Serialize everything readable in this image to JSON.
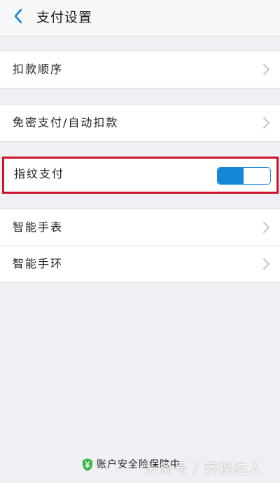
{
  "header": {
    "title": "支付设置",
    "back_icon": "chevron-left-icon"
  },
  "groups": [
    {
      "rows": [
        {
          "label": "扣款顺序",
          "icon": "chevron-right-icon"
        }
      ]
    },
    {
      "rows": [
        {
          "label": "免密支付/自动扣款",
          "icon": "chevron-right-icon"
        }
      ]
    },
    {
      "rows": [
        {
          "label": "指纹支付",
          "toggle_on": true
        }
      ]
    },
    {
      "rows": [
        {
          "label": "智能手表",
          "icon": "chevron-right-icon"
        },
        {
          "label": "智能手环",
          "icon": "chevron-right-icon"
        }
      ]
    }
  ],
  "footer": {
    "text": "账户安全险保障中",
    "icon": "shield-yen-icon"
  },
  "watermark": "头条号 / 转换达人",
  "colors": {
    "accent": "#1487d8",
    "highlight": "#d0112b",
    "background": "#efeff4",
    "shield": "#3bb54a"
  }
}
